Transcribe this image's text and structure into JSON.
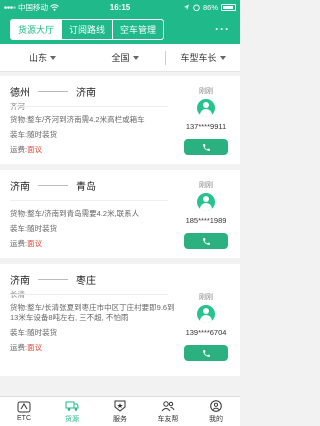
{
  "status": {
    "carrier": "中国移动",
    "time": "16:15",
    "battery": "86%"
  },
  "header": {
    "tabs": [
      {
        "label": "货源大厅",
        "active": true
      },
      {
        "label": "订阅路线",
        "active": false
      },
      {
        "label": "空车管理",
        "active": false
      }
    ],
    "more": "···"
  },
  "filters": {
    "origin": "山东",
    "destination": "全国",
    "vehicle": "车型车长"
  },
  "listings": [
    {
      "from": "德州",
      "to": "济南",
      "sub": "齐河",
      "cargo_label": "货物:",
      "cargo": "整车/齐河到济南需4.2米高栏或箱车",
      "load_label": "装车:",
      "load": "随时装货",
      "fee_label": "运费:",
      "fee": "面议",
      "time": "刚刚",
      "phone": "137****9911"
    },
    {
      "from": "济南",
      "to": "青岛",
      "sub": "",
      "cargo_label": "货物:",
      "cargo": "整车/济南到青岛需要4.2米,联系人",
      "load_label": "装车:",
      "load": "随时装货",
      "fee_label": "运费:",
      "fee": "面议",
      "time": "刚刚",
      "phone": "185****1989"
    },
    {
      "from": "济南",
      "to": "枣庄",
      "sub": "长清",
      "cargo_label": "货物:",
      "cargo": "整车/长清张夏到枣庄市中区丁庄村要即9.6到13米车设备8吨左右, 三不超, 不怕雨",
      "load_label": "装车:",
      "load": "随时装货",
      "fee_label": "运费:",
      "fee": "面议",
      "time": "刚刚",
      "phone": "139****6704"
    }
  ],
  "nav": [
    {
      "label": "ETC",
      "icon": "etc-icon",
      "active": false
    },
    {
      "label": "货源",
      "icon": "truck-icon",
      "active": true
    },
    {
      "label": "服务",
      "icon": "star-shield-icon",
      "active": false
    },
    {
      "label": "车友帮",
      "icon": "group-icon",
      "active": false
    },
    {
      "label": "我的",
      "icon": "profile-icon",
      "active": false
    }
  ]
}
